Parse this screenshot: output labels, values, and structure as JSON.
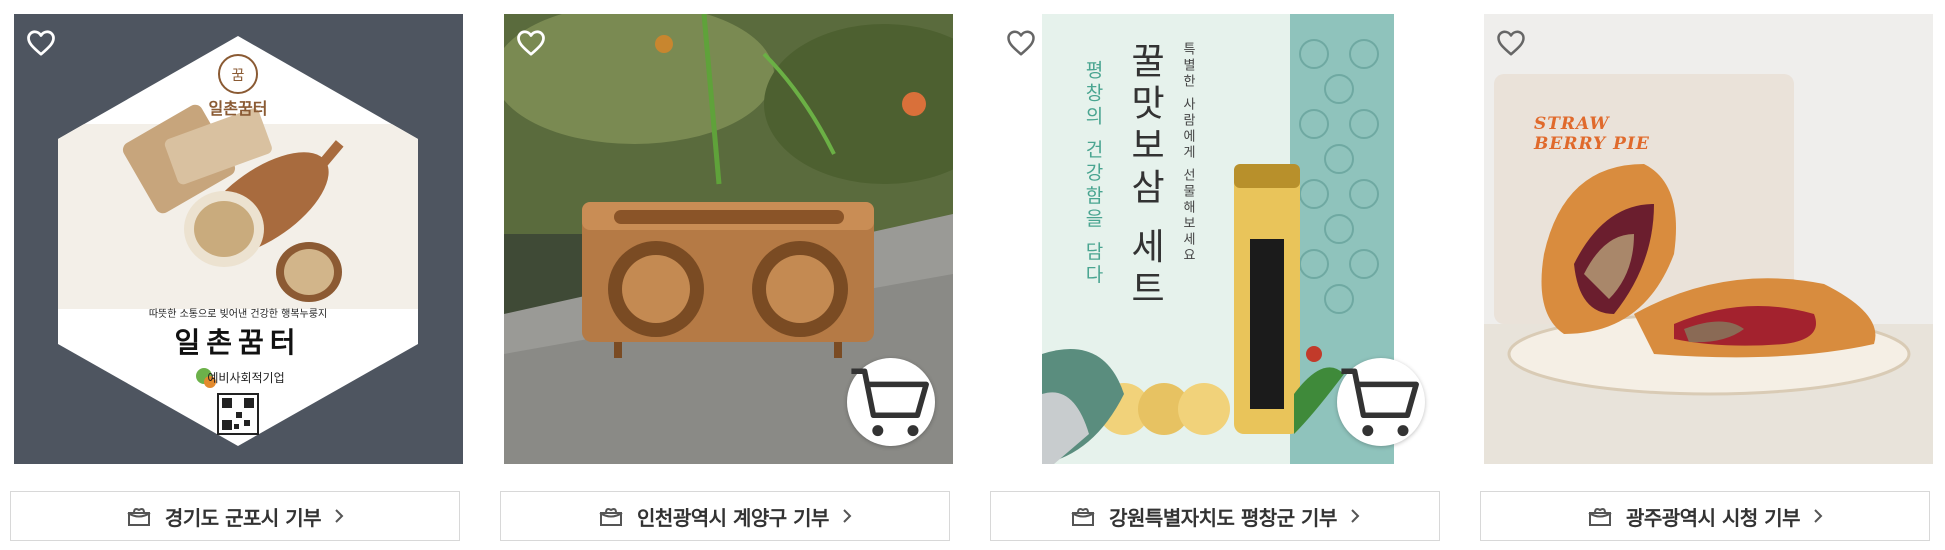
{
  "products": [
    {
      "donate_label": "경기도 군포시 기부",
      "image_text": {
        "brand": "일촌꿈터",
        "tagline": "따뜻한 소통으로 빚어낸 건강한 행복누룽지",
        "company": "예비사회적기업"
      },
      "wishlisted": false,
      "has_cart_button": false
    },
    {
      "donate_label": "인천광역시 계양구 기부",
      "image_text": {},
      "wishlisted": false,
      "has_cart_button": true
    },
    {
      "donate_label": "강원특별자치도 평창군 기부",
      "image_text": {
        "title": "꿀맛보삼 세트",
        "subtitle": "평창의 건강함을 담다",
        "note": "특별한 사람에게 선물해보세요"
      },
      "wishlisted": false,
      "has_cart_button": true
    },
    {
      "donate_label": "광주광역시 시청 기부",
      "image_text": {
        "package": "STRAW BERRY PIE"
      },
      "wishlisted": false,
      "has_cart_button": false
    }
  ],
  "icons": {
    "wishlist": "heart-outline-icon",
    "cart": "cart-icon",
    "donate": "gift-box-icon",
    "more": "chevron-right-icon"
  },
  "colors": {
    "heart": "#ffffff",
    "border": "#d8d8d8",
    "label": "#333333"
  }
}
